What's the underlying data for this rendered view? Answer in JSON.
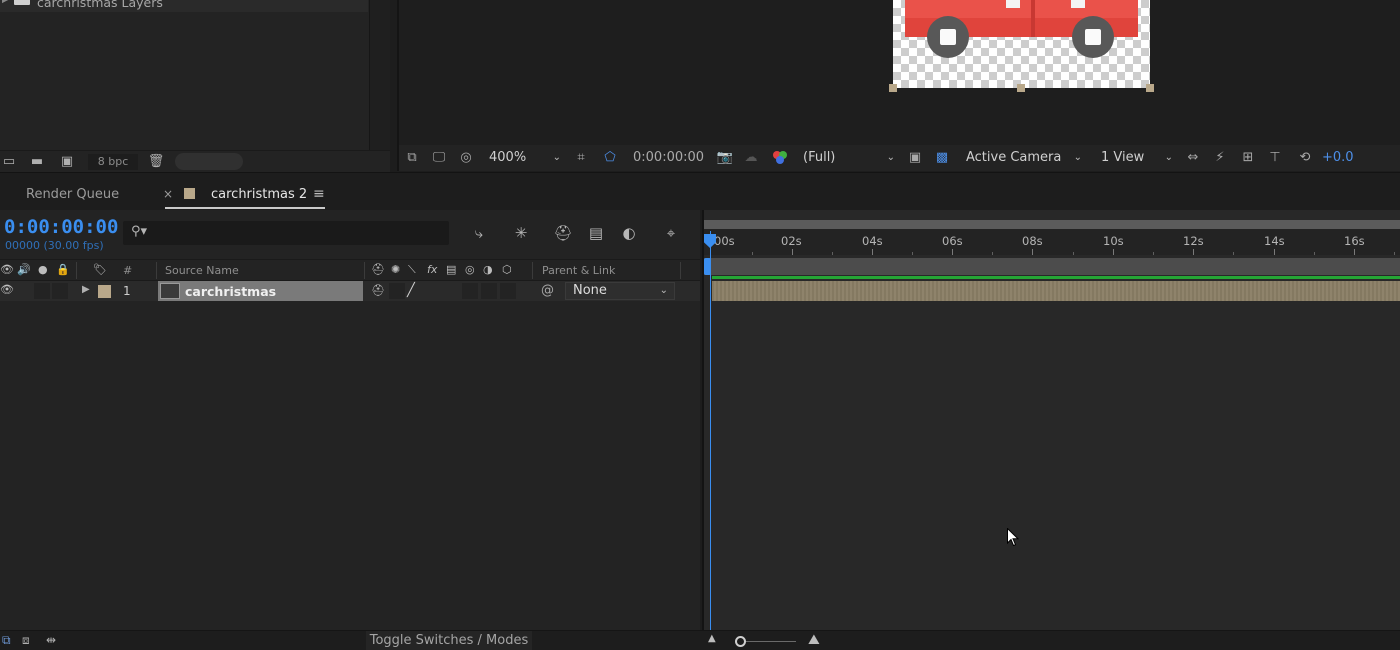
{
  "project": {
    "folder_label": "carchristmas Layers",
    "bpc": "8 bpc"
  },
  "viewer": {
    "zoom": "400%",
    "timecode": "0:00:00:00",
    "resolution": "(Full)",
    "camera": "Active Camera",
    "views": "1 View",
    "exposure": "+0.0"
  },
  "tabs": {
    "render_queue": "Render Queue",
    "close": "×",
    "comp": "carchristmas 2",
    "menu": "≡"
  },
  "timeline": {
    "current_time": "0:00:00:00",
    "frame_info": "00000 (30.00 fps)",
    "columns": {
      "number": "#",
      "source_name": "Source Name",
      "parent_link": "Parent & Link"
    },
    "layer": {
      "index": "1",
      "name": "carchristmas",
      "parent": "None"
    },
    "ruler": [
      "00s",
      "02s",
      "04s",
      "06s",
      "08s",
      "10s",
      "12s",
      "14s",
      "16s"
    ]
  },
  "bottom": {
    "toggle_label": "Toggle Switches / Modes"
  },
  "colors": {
    "accent": "#3a8ef0",
    "layer_label": "#b9a88a",
    "car_red": "#e0443c",
    "track_green": "#25a535"
  }
}
